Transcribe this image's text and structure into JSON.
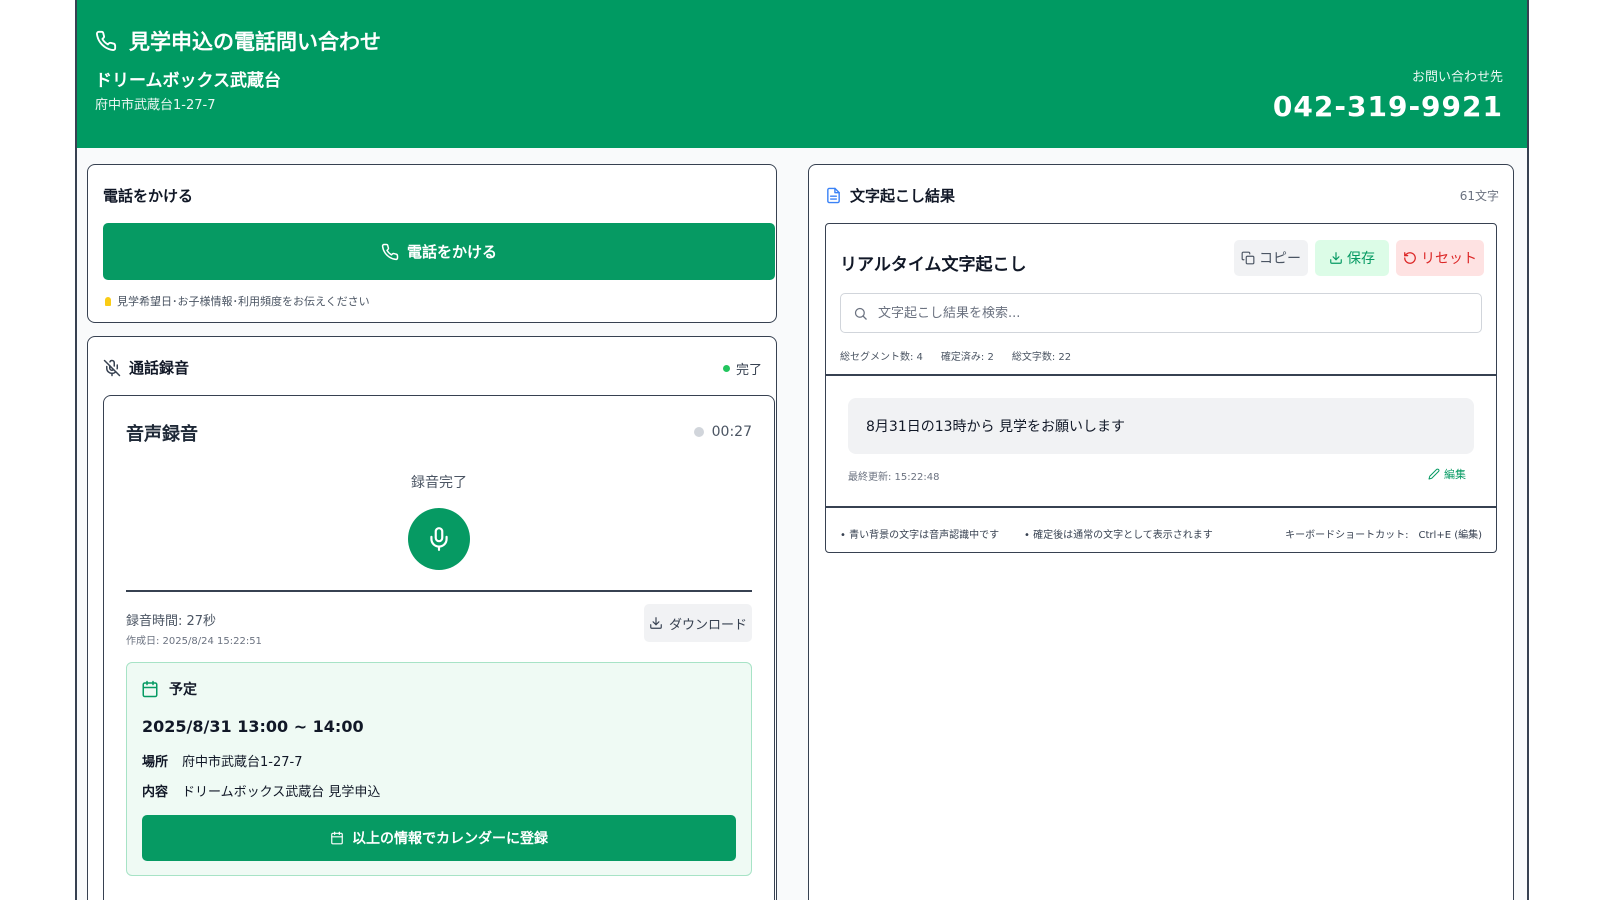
{
  "header": {
    "title": "見学申込の電話問い合わせ",
    "facility": "ドリームボックス武蔵台",
    "address": "府中市武蔵台1-27-7",
    "contact_label": "お問い合わせ先",
    "phone": "042-319-9921"
  },
  "call": {
    "title": "電話をかける",
    "button_label": "電話をかける",
    "hint": "見学希望日･お子様情報･利用頻度をお伝えください"
  },
  "recording": {
    "title": "通話録音",
    "status": "完了",
    "card_title": "音声録音",
    "timer": "00:27",
    "state": "録音完了",
    "duration": "録音時間: 27秒",
    "created": "作成日: 2025/8/24 15:22:51",
    "download_label": "ダウンロード"
  },
  "schedule": {
    "heading": "予定",
    "datetime": "2025/8/31 13:00 ~ 14:00",
    "place_key": "場所",
    "place_value": "府中市武蔵台1-27-7",
    "content_key": "内容",
    "content_value": "ドリームボックス武蔵台 見学申込",
    "register_label": "以上の情報でカレンダーに登録"
  },
  "transcript": {
    "title": "文字起こし結果",
    "char_count": "61文字",
    "card_title": "リアルタイム文字起こし",
    "copy_label": "コピー",
    "save_label": "保存",
    "reset_label": "リセット",
    "search_placeholder": "文字起こし結果を検索...",
    "stats": {
      "segments": "総セグメント数: 4",
      "confirmed": "確定済み: 2",
      "chars": "総文字数: 22"
    },
    "segment_text": "8月31日の13時から 見学をお願いします",
    "last_updated": "最終更新: 15:22:48",
    "edit_label": "編集",
    "note1": "• 青い背景の文字は音声認識中です",
    "note2": "• 確定後は通常の文字として表示されます",
    "shortcut": "キーボードショートカット:　Ctrl+E (編集)"
  },
  "colors": {
    "brand": "#009a62",
    "button": "#069a63",
    "reset": "#dc2626",
    "status_done": "#22c55e"
  }
}
